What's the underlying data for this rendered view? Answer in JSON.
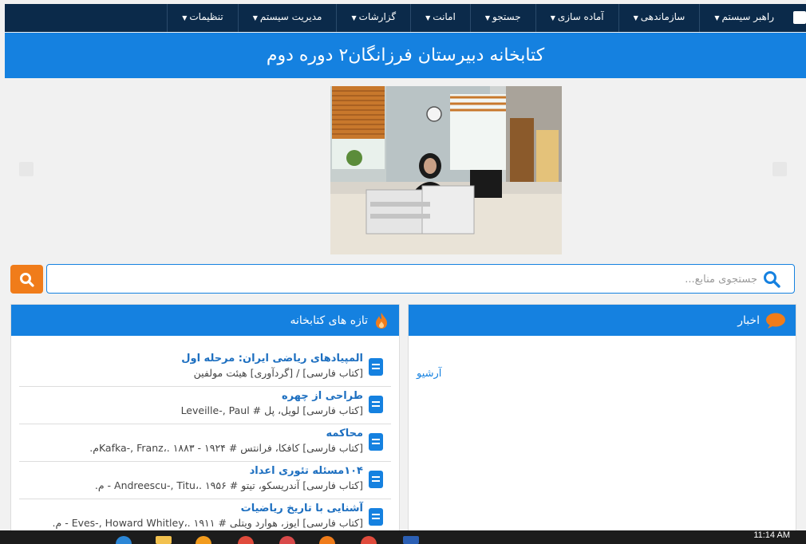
{
  "nav": {
    "items": [
      {
        "label": "راهبر سیستم"
      },
      {
        "label": "سازماندهی"
      },
      {
        "label": "آماده سازی"
      },
      {
        "label": "جستجو"
      },
      {
        "label": "امانت"
      },
      {
        "label": "گزارشات"
      },
      {
        "label": "مدیریت سیستم"
      },
      {
        "label": "تنظیمات"
      }
    ]
  },
  "header": {
    "title": "کتابخانه دبیرستان فرزانگان۲ دوره دوم"
  },
  "search": {
    "placeholder": "جستجوی منابع..."
  },
  "news": {
    "title": "اخبار",
    "archive_label": "آرشیو"
  },
  "recent": {
    "title": "تازه های کتابخانه",
    "items": [
      {
        "title": "المپیادهای ریاضی ایران: مرحله اول",
        "meta": "[کتاب فارسی] / [گردآوری] هیئت مولفین"
      },
      {
        "title": "طراحی از چهره",
        "meta": "[کتاب فارسی] لویل، پل # Leveille-, Paul"
      },
      {
        "title": "محاکمه",
        "meta": "[کتاب فارسی] کافکا، فرانتس # ۱۹۲۴ - ۱۸۸۳ .،Kafka-, Franzم."
      },
      {
        "title": "۱۰۴مسئله تئوری اعداد",
        "meta": "[کتاب فارسی] آندریسکو، تیتو # ۱۹۵۶ .،Andreescu-, Titu - م."
      },
      {
        "title": "آشنایی با تاریخ ریاضیات",
        "meta": "[کتاب فارسی] ایوز، هوارد ویتلی # ۱۹۱۱ .،Eves-, Howard Whitley - م."
      }
    ]
  },
  "taskbar": {
    "time": "11:14 AM"
  },
  "colors": {
    "nav_bg": "#0b2a4a",
    "brand_blue": "#1581e0",
    "search_orange": "#f07c1a"
  }
}
